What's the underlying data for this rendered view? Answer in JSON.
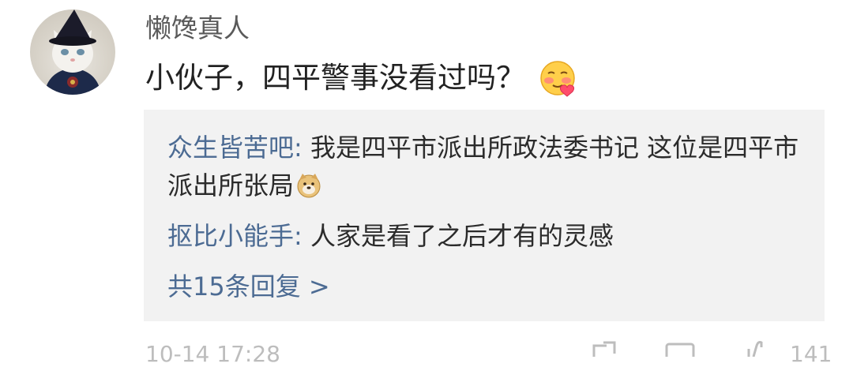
{
  "comment": {
    "username": "懒馋真人",
    "text": "小伙子，四平警事没看过吗？",
    "emoji": "flushed-hearts-emoji"
  },
  "replies": [
    {
      "name": "众生皆苦吧:",
      "text": " 我是四平市派出所政法委书记 这位是四平市派出所张局",
      "emoji": "doge-emoji"
    },
    {
      "name": "抠比小能手:",
      "text": " 人家是看了之后才有的灵感"
    }
  ],
  "more_replies": "共15条回复 >",
  "footer": {
    "timestamp": "10-14 17:28",
    "like_count": "141"
  },
  "colors": {
    "link": "#4c6b93",
    "reply_bg": "#f2f2f2",
    "username": "#5a5a5a"
  }
}
